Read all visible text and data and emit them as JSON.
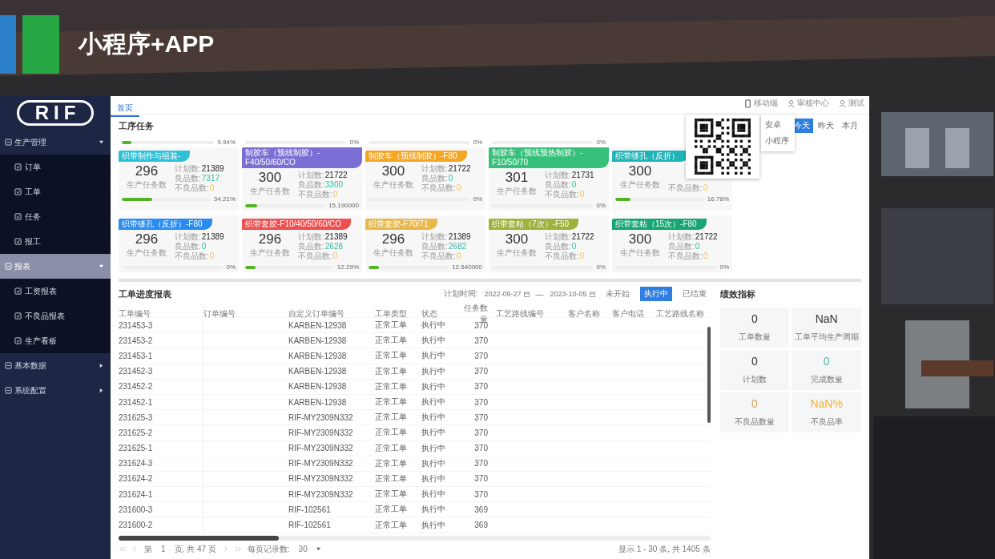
{
  "slide": {
    "title": "小程序+APP"
  },
  "sidebar": {
    "logo": "RIF",
    "items": [
      {
        "label": "生产管理",
        "selected": false,
        "expanded": true,
        "children": [
          {
            "label": "订单",
            "selected": false
          },
          {
            "label": "工单",
            "selected": false
          },
          {
            "label": "任务",
            "selected": false
          },
          {
            "label": "报工",
            "selected": false
          }
        ]
      },
      {
        "label": "报表",
        "selected": true,
        "expanded": true,
        "children": [
          {
            "label": "工资报表",
            "selected": false
          },
          {
            "label": "不良品报表",
            "selected": false
          },
          {
            "label": "生产看板",
            "selected": false
          }
        ]
      },
      {
        "label": "基本数据",
        "selected": false,
        "expanded": false
      },
      {
        "label": "系统配置",
        "selected": false,
        "expanded": false
      }
    ]
  },
  "tabs": [
    {
      "label": "首页",
      "selected": true
    }
  ],
  "header_links": [
    "移动端",
    "审核中心",
    "测试"
  ],
  "mobile_menu": [
    "安卓",
    "小程序"
  ],
  "tasks": {
    "title": "工序任务",
    "periods": [
      {
        "label": "今天",
        "selected": true
      },
      {
        "label": "昨天",
        "selected": false
      },
      {
        "label": "本月",
        "selected": false
      }
    ],
    "top_progress": [
      {
        "percent": "9.94%",
        "level": 0.1
      },
      {
        "percent": "0%"
      },
      {
        "percent": "0%"
      },
      {
        "percent": "0%"
      }
    ],
    "cards": [
      {
        "title": "织带制作与组装-",
        "color": "#2ec0d8",
        "tasks": "296",
        "task_label": "生产任务数",
        "planned_label": "计划数:",
        "planned": "21389",
        "good_label": "良品数:",
        "good": "7317",
        "bad_label": "不良品数:",
        "bad": "0",
        "percent": "34.21%",
        "level": 0.34
      },
      {
        "title": "制胶车（预线制胶）-F40/50/60/CO",
        "color": "#7b6fd6",
        "tasks": "300",
        "task_label": "生产任务数",
        "planned_label": "计划数:",
        "planned": "21722",
        "good_label": "良品数:",
        "good": "3300",
        "bad_label": "不良品数:",
        "bad": "0",
        "percent": "15.190000",
        "level": 0.15
      },
      {
        "title": "制胶车（预线制胶）-F80",
        "color": "#f4a623",
        "tasks": "300",
        "task_label": "生产任务数",
        "planned_label": "计划数:",
        "planned": "21722",
        "good_label": "良品数:",
        "good": "0",
        "bad_label": "不良品数:",
        "bad": "0",
        "percent": "0%"
      },
      {
        "title": "制胶车（预线预热制胶）-F10/50/70",
        "color": "#36c07a",
        "tasks": "301",
        "task_label": "生产任务数",
        "planned_label": "计划数:",
        "planned": "21731",
        "good_label": "良品数:",
        "good": "0",
        "bad_label": "不良品数:",
        "bad": "0",
        "percent": "0%"
      },
      {
        "title": "织带缝孔（反折）",
        "color": "#1fb5b8",
        "tasks": "300",
        "task_label": "生产任务数",
        "bad_label": "不良品数:",
        "bad": "0",
        "percent": "16.78%",
        "level": 0.17
      },
      {
        "title": "织带缝孔（反折）-F80",
        "color": "#2a8cf0",
        "tasks": "296",
        "task_label": "生产任务数",
        "planned_label": "计划数:",
        "planned": "21389",
        "good_label": "良品数:",
        "good": "0",
        "bad_label": "不良品数:",
        "bad": "0",
        "percent": "0%"
      },
      {
        "title": "织带套胶-F10/40/50/60/CO",
        "color": "#ef4f4f",
        "tasks": "296",
        "task_label": "生产任务数",
        "planned_label": "计划数:",
        "planned": "21389",
        "good_label": "良品数:",
        "good": "2628",
        "bad_label": "不良品数:",
        "bad": "0",
        "percent": "12.29%",
        "level": 0.12
      },
      {
        "title": "织带套胶-F70/71",
        "color": "#e8b84a",
        "tasks": "296",
        "task_label": "生产任务数",
        "planned_label": "计划数:",
        "planned": "21389",
        "good_label": "良品数:",
        "good": "2682",
        "bad_label": "不良品数:",
        "bad": "0",
        "percent": "12.540000",
        "level": 0.125
      },
      {
        "title": "织带套粘（7次）-F50",
        "color": "#9db33c",
        "tasks": "300",
        "task_label": "生产任务数",
        "planned_label": "计划数:",
        "planned": "21722",
        "good_label": "良品数:",
        "good": "0",
        "bad_label": "不良品数:",
        "bad": "0",
        "percent": "0%"
      },
      {
        "title": "织带套粘（15次）-F80",
        "color": "#17a673",
        "tasks": "300",
        "task_label": "生产任务数",
        "planned_label": "计划数:",
        "planned": "21722",
        "good_label": "良品数:",
        "good": "0",
        "bad_label": "不良品数:",
        "bad": "0",
        "percent": "0%"
      }
    ]
  },
  "report": {
    "title": "工单进度报表",
    "date_label": "计划时间:",
    "date_from": "2022-09-27",
    "dash": "—",
    "date_to": "2023-10-05",
    "filters": [
      {
        "label": "未开始",
        "selected": false
      },
      {
        "label": "执行中",
        "selected": true
      },
      {
        "label": "已结束",
        "selected": false
      }
    ],
    "columns": [
      "工单编号",
      "订单编号",
      "自定义订单编号",
      "工单类型",
      "状态",
      "任务数量",
      "工艺路线编号",
      "客户名称",
      "客户电话",
      "工艺路线名称"
    ],
    "rows": [
      {
        "no": "231453-3",
        "custom": "KARBEN-12938",
        "type": "正常工单",
        "state": "执行中",
        "qty": "370"
      },
      {
        "no": "231453-2",
        "custom": "KARBEN-12938",
        "type": "正常工单",
        "state": "执行中",
        "qty": "370"
      },
      {
        "no": "231453-1",
        "custom": "KARBEN-12938",
        "type": "正常工单",
        "state": "执行中",
        "qty": "370"
      },
      {
        "no": "231452-3",
        "custom": "KARBEN-12938",
        "type": "正常工单",
        "state": "执行中",
        "qty": "370"
      },
      {
        "no": "231452-2",
        "custom": "KARBEN-12938",
        "type": "正常工单",
        "state": "执行中",
        "qty": "370"
      },
      {
        "no": "231452-1",
        "custom": "KARBEN-12938",
        "type": "正常工单",
        "state": "执行中",
        "qty": "370"
      },
      {
        "no": "231625-3",
        "custom": "RIF-MY2309N332",
        "type": "正常工单",
        "state": "执行中",
        "qty": "370"
      },
      {
        "no": "231625-2",
        "custom": "RIF-MY2309N332",
        "type": "正常工单",
        "state": "执行中",
        "qty": "370"
      },
      {
        "no": "231625-1",
        "custom": "RIF-MY2309N332",
        "type": "正常工单",
        "state": "执行中",
        "qty": "370"
      },
      {
        "no": "231624-3",
        "custom": "RIF-MY2309N332",
        "type": "正常工单",
        "state": "执行中",
        "qty": "370"
      },
      {
        "no": "231624-2",
        "custom": "RIF-MY2309N332",
        "type": "正常工单",
        "state": "执行中",
        "qty": "370"
      },
      {
        "no": "231624-1",
        "custom": "RIF-MY2309N332",
        "type": "正常工单",
        "state": "执行中",
        "qty": "370"
      },
      {
        "no": "231600-3",
        "custom": "RIF-102561",
        "type": "正常工单",
        "state": "执行中",
        "qty": "369"
      },
      {
        "no": "231600-2",
        "custom": "RIF-102561",
        "type": "正常工单",
        "state": "执行中",
        "qty": "369"
      }
    ],
    "pager": {
      "prefix": "第",
      "page": "1",
      "suffix": "页, 共 47 页",
      "per_page_label": "每页记录数:",
      "per_page": "30",
      "summary": "显示 1 - 30 条, 共 1405 条"
    }
  },
  "metrics": {
    "title": "绩效指标",
    "items": [
      {
        "value": "0",
        "label": "工单数量",
        "color": "#333333"
      },
      {
        "value": "NaN",
        "label": "工单平均生产周期",
        "color": "#333333"
      },
      {
        "value": "0",
        "label": "计划数",
        "color": "#333333"
      },
      {
        "value": "0",
        "label": "完成数量",
        "color": "#4fb3a9"
      },
      {
        "value": "0",
        "label": "不良品数量",
        "color": "#d9a05b"
      },
      {
        "value": "NaN%",
        "label": "不良品率",
        "color": "#f2b233"
      }
    ]
  }
}
